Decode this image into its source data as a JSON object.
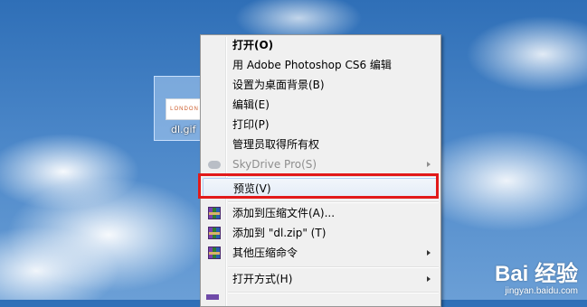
{
  "desktop": {
    "file_icon": {
      "label": "dl.gif",
      "thumbnail_text": "LONDON"
    }
  },
  "context_menu": {
    "items": [
      {
        "label": "打开(O)",
        "bold": true
      },
      {
        "label": "用 Adobe Photoshop CS6 编辑"
      },
      {
        "label": "设置为桌面背景(B)"
      },
      {
        "label": "编辑(E)"
      },
      {
        "label": "打印(P)"
      },
      {
        "label": "管理员取得所有权"
      },
      {
        "label": "SkyDrive Pro(S)",
        "disabled": true,
        "submenu": true,
        "icon": "cloud-icon"
      },
      {
        "label": "预览(V)",
        "highlighted": true
      },
      {
        "label": "添加到压缩文件(A)...",
        "icon": "winrar-icon"
      },
      {
        "label": "添加到 \"dl.zip\" (T)",
        "icon": "winrar-icon"
      },
      {
        "label": "其他压缩命令",
        "submenu": true,
        "icon": "winrar-icon"
      },
      {
        "label": "打开方式(H)",
        "submenu": true
      }
    ]
  },
  "annotation": {
    "highlight_color": "#e21a1a"
  },
  "watermark": {
    "logo": "Bai 经验",
    "url": "jingyan.baidu.com"
  }
}
